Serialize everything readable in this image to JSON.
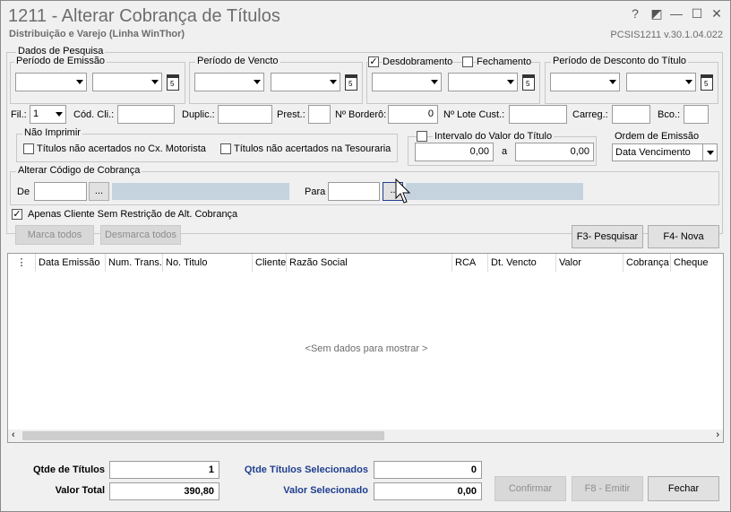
{
  "window": {
    "title": "1211 - Alterar Cobrança de Títulos",
    "subtitle": "Distribuição e Varejo (Linha WinThor)",
    "version": "PCSIS1211  v.30.1.04.022"
  },
  "search": {
    "group_label": "Dados de Pesquisa",
    "periodo_emissao": "Período de Emissão",
    "periodo_vencto": "Período de Vencto",
    "desdobramento": "Desdobramento",
    "fechamento": "Fechamento",
    "periodo_desconto": "Período de Desconto do Título",
    "fil_label": "Fil.:",
    "fil_value": "1",
    "cod_cli": "Cód. Cli.:",
    "duplic": "Duplic.:",
    "prest": "Prest.:",
    "bordero": "Nº Borderô:",
    "bordero_value": "0",
    "lote_cust": "Nº Lote Cust.:",
    "carreg": "Carreg.:",
    "bco": "Bco.:"
  },
  "nao_imprimir": {
    "label": "Não Imprimir",
    "opt1": "Títulos não acertados no Cx. Motorista",
    "opt2": "Títulos não acertados na Tesouraria"
  },
  "intervalo": {
    "label": "Intervalo do Valor do Título",
    "from": "0,00",
    "sep": "a",
    "to": "0,00"
  },
  "ordem": {
    "label": "Ordem de Emissão",
    "value": "Data Vencimento"
  },
  "alterar": {
    "label": "Alterar Código de Cobrança",
    "de": "De",
    "para": "Para",
    "dots": "...",
    "dots2": ".."
  },
  "apenas": "Apenas Cliente Sem Restrição de Alt. Cobrança",
  "buttons": {
    "marca": "Marca todos",
    "desmarca": "Desmarca todos",
    "pesquisar": "F3- Pesquisar",
    "nova": "F4- Nova",
    "confirmar": "Confirmar",
    "emitir": "F8 - Emitir",
    "fechar": "Fechar"
  },
  "grid": {
    "columns": [
      "Data Emissão",
      "Num. Trans.",
      "No. Titulo",
      "Cliente",
      "Razão Social",
      "RCA",
      "Dt. Vencto",
      "Valor",
      "Cobrança",
      "Cheque"
    ],
    "empty": "<Sem dados para mostrar >"
  },
  "footer": {
    "qtde_titulos_label": "Qtde de Títulos",
    "qtde_titulos": "1",
    "valor_total_label": "Valor Total",
    "valor_total": "390,80",
    "qtde_sel_label": "Qtde Títulos Selecionados",
    "qtde_sel": "0",
    "valor_sel_label": "Valor Selecionado",
    "valor_sel": "0,00"
  },
  "colors": {
    "accent": "#1f3f8f",
    "disabled_field": "#c5d3df"
  }
}
